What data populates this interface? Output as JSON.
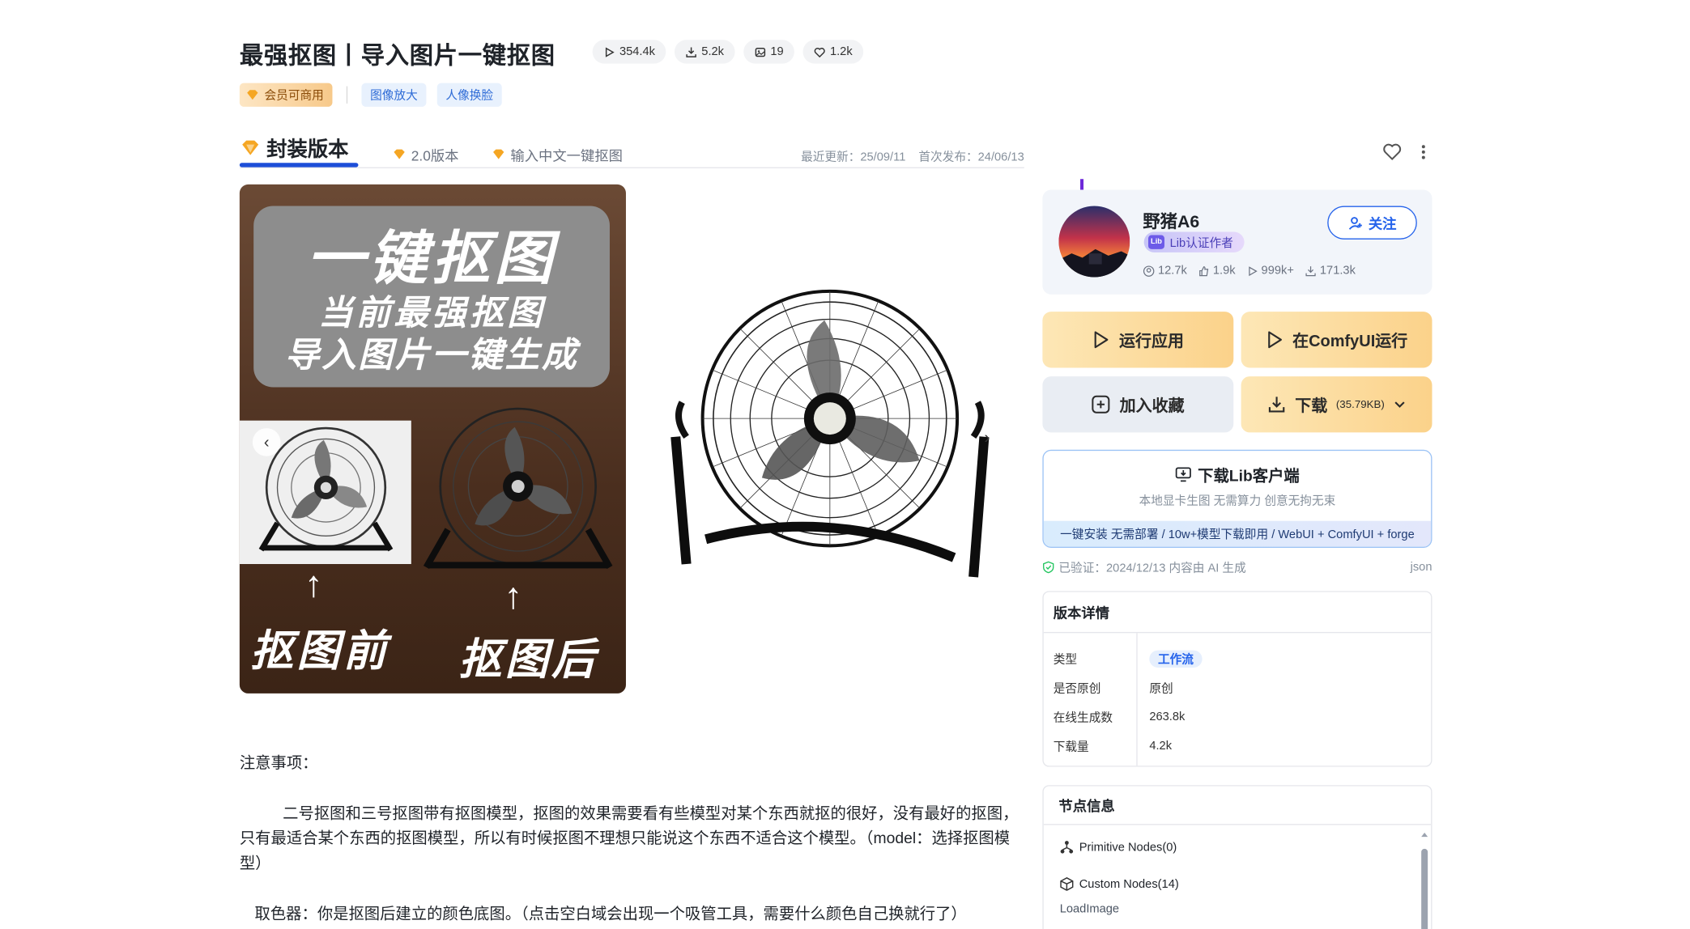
{
  "header": {
    "title": "最强抠图丨导入图片一键抠图",
    "stats": {
      "runs": "354.4k",
      "downloads": "5.2k",
      "images": "19",
      "likes": "1.2k"
    },
    "tags": {
      "vip": "会员可商用",
      "items": [
        "图像放大",
        "人像换脸"
      ]
    }
  },
  "versions": {
    "tabs": [
      "封装版本",
      "2.0版本",
      "输入中文一键抠图"
    ],
    "last_updated": "最近更新：25/09/11",
    "first_published": "首次发布：24/06/13"
  },
  "gallery": {
    "banner_line1": "一键抠图",
    "banner_line2": "当前最强抠图",
    "banner_line3": "导入图片一键生成",
    "label_before": "抠图前",
    "label_after": "抠图后",
    "prev": "‹",
    "next": "›"
  },
  "description": {
    "heading": "注意事项：",
    "para1": "二号抠图和三号抠图带有抠图模型，抠图的效果需要看有些模型对某个东西就抠的很好，没有最好的抠图，只有最适合某个东西的抠图模型，所以有时候抠图不理想只能说这个东西不适合这个模型。（model：选择抠图模型）",
    "para2": "取色器：你是抠图后建立的颜色底图。（点击空白域会出现一个吸管工具，需要什么颜色自己换就行了）"
  },
  "author": {
    "name": "野猪A6",
    "badge": "Lib认证作者",
    "badge_logo": "Lib",
    "follow": "关注",
    "stats": {
      "followers": "12.7k",
      "downloads": "1.9k",
      "runs": "999k+",
      "total_downloads": "171.3k"
    }
  },
  "actions": {
    "run_app": "运行应用",
    "run_comfyui": "在ComfyUI运行",
    "favorite": "加入收藏",
    "download": "下载",
    "download_size": "(35.79KB)"
  },
  "client": {
    "title": "下载Lib客户端",
    "subtitle": "本地显卡生图 无需算力 创意无拘无束",
    "strip": "一键安装 无需部署 / 10w+模型下载即用 / WebUI + ComfyUI + forge"
  },
  "verified": {
    "text": "已验证：2024/12/13 内容由 AI 生成",
    "json": "json"
  },
  "details": {
    "heading": "版本详情",
    "rows": [
      {
        "key": "类型",
        "value": "工作流"
      },
      {
        "key": "是否原创",
        "value": "原创"
      },
      {
        "key": "在线生成数",
        "value": "263.8k"
      },
      {
        "key": "下载量",
        "value": "4.2k"
      }
    ]
  },
  "nodes": {
    "heading": "节点信息",
    "primitive": "Primitive Nodes(0)",
    "custom": "Custom Nodes(14)",
    "items": [
      "LoadImage"
    ]
  },
  "colors": {
    "accent_blue": "#2563eb",
    "tab_underline": "#1d4ed8",
    "action_yellow": "#fbd28a",
    "action_grey": "#e9edf3",
    "author_card_bg": "#f2f5fa"
  }
}
